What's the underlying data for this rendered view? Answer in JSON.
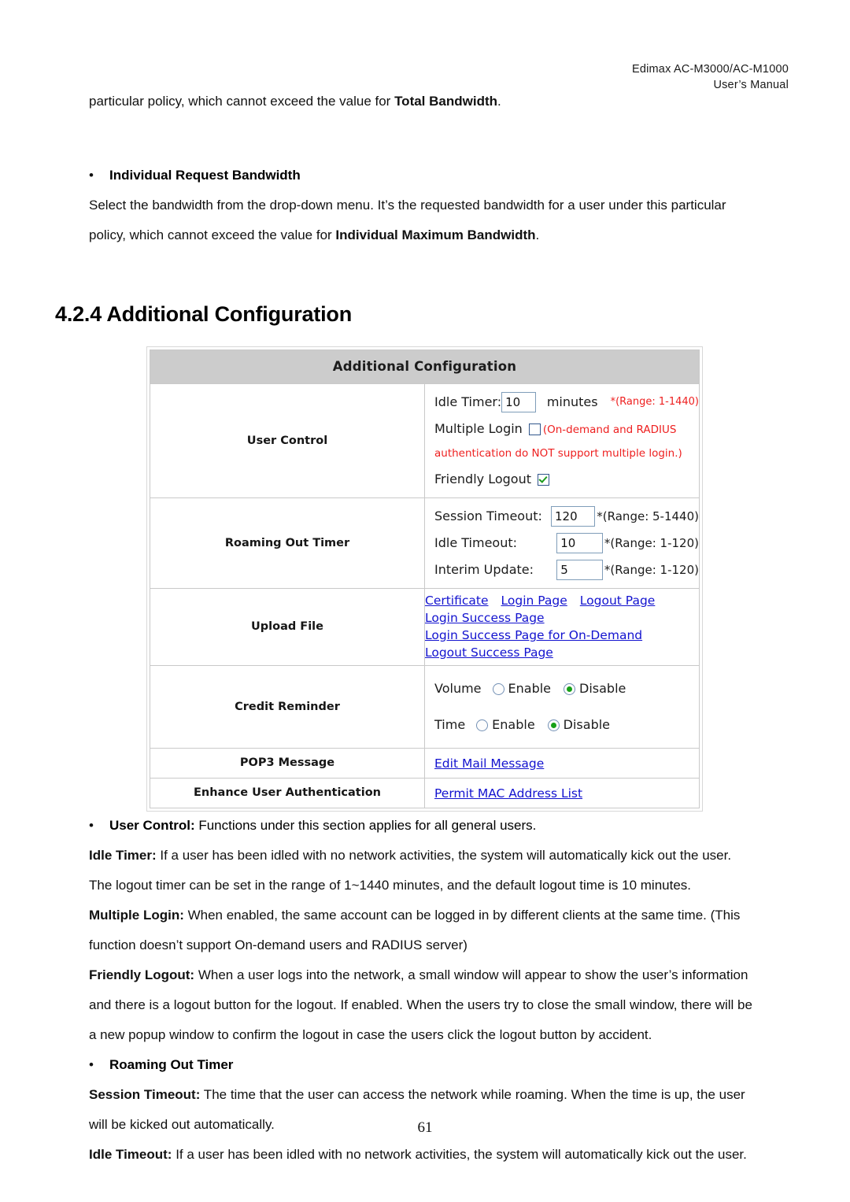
{
  "header": {
    "line1": "Edimax  AC-M3000/AC-M1000",
    "line2": "User’s  Manual"
  },
  "top_text": {
    "para1_pre": "particular policy, which cannot exceed the value for ",
    "para1_bold": "Total Bandwidth",
    "para1_post": ".",
    "bullet1": "•",
    "bullet1_label": "Individual Request Bandwidth",
    "para2": "Select the bandwidth from the drop-down menu. It’s the requested bandwidth for a user under this particular",
    "para3_pre": "policy, which cannot exceed the value for ",
    "para3_bold": "Individual Maximum Bandwidth",
    "para3_post": "."
  },
  "section": {
    "heading": "4.2.4 Additional Configuration"
  },
  "screenshot": {
    "title": "Additional Configuration",
    "rows": {
      "user_control": {
        "label": "User Control",
        "idle_timer_label": "Idle Timer:",
        "idle_timer_value": "10",
        "idle_timer_units": "minutes",
        "idle_timer_range": "*(Range: 1-1440)",
        "multiple_login_label": "Multiple Login",
        "multiple_login_checked": false,
        "multiple_login_note": "(On-demand and RADIUS authentication do NOT support multiple login.)",
        "friendly_logout_label": "Friendly Logout",
        "friendly_logout_checked": true
      },
      "roaming_out_timer": {
        "label": "Roaming Out Timer",
        "fields": [
          {
            "label": "Session Timeout:",
            "value": "120",
            "range": "*(Range: 5-1440)"
          },
          {
            "label": "Idle Timeout:",
            "value": "10",
            "range": "*(Range: 1-120)"
          },
          {
            "label": "Interim Update:",
            "value": "5",
            "range": "*(Range: 1-120)"
          }
        ]
      },
      "upload_file": {
        "label": "Upload File",
        "links_line1": [
          "Certificate",
          "Login Page",
          "Logout Page",
          "Login Success Page"
        ],
        "links_line2": [
          "Login Success Page for On-Demand",
          "Logout Success Page"
        ]
      },
      "credit_reminder": {
        "label": "Credit Reminder",
        "groups": [
          {
            "name": "Volume",
            "enable": "Enable",
            "disable": "Disable",
            "selected": "Disable"
          },
          {
            "name": "Time",
            "enable": "Enable",
            "disable": "Disable",
            "selected": "Disable"
          }
        ]
      },
      "pop3_message": {
        "label": "POP3 Message",
        "link": "Edit Mail Message"
      },
      "enhance_user_auth": {
        "label": "Enhance User Authentication",
        "link": "Permit MAC Address List"
      }
    }
  },
  "lower_text": {
    "bullet": "•",
    "b1_bold": "User Control:",
    "b1_rest": " Functions under this section applies for all general users.",
    "p1_bold": "Idle Timer:",
    "p1_rest": " If a user has been idled with no network activities, the system will automatically kick out the user.",
    "p2": "The logout timer can be set in the range of 1~1440 minutes, and the default logout time is 10 minutes.",
    "p3_bold": "Multiple Login:",
    "p3_rest": " When enabled, the same account can be logged in by different clients at the same time. (This",
    "p4": "function doesn’t support On-demand users and RADIUS server)",
    "p5_bold": "Friendly Logout:",
    "p5_rest": " When a user logs into the network, a small window will appear to show the user’s information",
    "p6": "and there is a logout button for the logout. If enabled. When the users try to close the small window, there will be",
    "p7": "a new popup window to confirm the logout in case the users click the logout button by accident.",
    "b2_label": "Roaming Out Timer",
    "p8_bold": "Session Timeout:",
    "p8_rest": " The time that the user can access the network while roaming. When the time is up, the user",
    "p9": "will be kicked out automatically.",
    "p10_bold": "Idle Timeout:",
    "p10_rest": " If a user has been idled with no network activities, the system will automatically kick out the user."
  },
  "footer": {
    "page_number": "61"
  }
}
